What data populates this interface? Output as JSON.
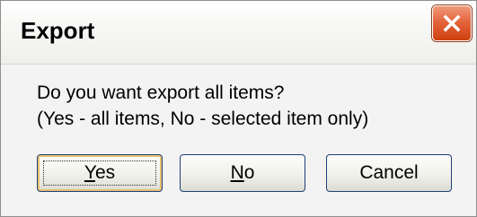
{
  "dialog": {
    "title": "Export",
    "message_line1": "Do you want export all items?",
    "message_line2": "(Yes - all items, No - selected item only)",
    "buttons": {
      "yes": {
        "accel": "Y",
        "rest": "es"
      },
      "no": {
        "accel": "N",
        "rest": "o"
      },
      "cancel": "Cancel"
    }
  },
  "colors": {
    "close_button": "#e4653c",
    "button_border": "#1d3f7a",
    "focus_ring": "#e9c26f"
  },
  "icons": {
    "close": "close-x-icon"
  }
}
